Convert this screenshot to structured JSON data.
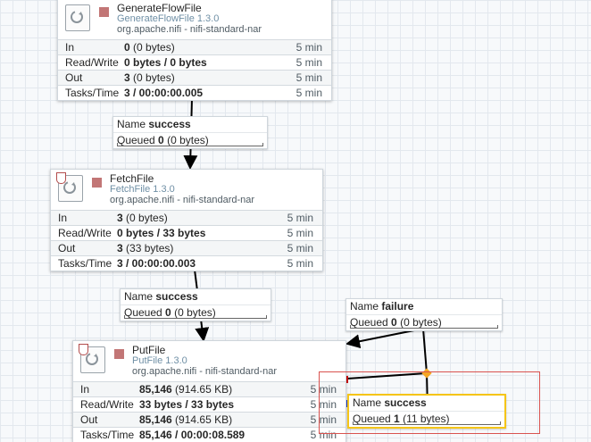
{
  "processors": [
    {
      "name": "GenerateFlowFile",
      "type": "GenerateFlowFile 1.3.0",
      "bundle": "org.apache.nifi - nifi-standard-nar",
      "stats": [
        {
          "label": "In",
          "count": "0",
          "detail": "(0 bytes)",
          "time": "5 min"
        },
        {
          "label": "Read/Write",
          "count": "0 bytes / 0 bytes",
          "detail": "",
          "time": "5 min"
        },
        {
          "label": "Out",
          "count": "3",
          "detail": "(0 bytes)",
          "time": "5 min"
        },
        {
          "label": "Tasks/Time",
          "count": "3 / 00:00:00.005",
          "detail": "",
          "time": "5 min"
        }
      ]
    },
    {
      "name": "FetchFile",
      "type": "FetchFile 1.3.0",
      "bundle": "org.apache.nifi - nifi-standard-nar",
      "stats": [
        {
          "label": "In",
          "count": "3",
          "detail": "(0 bytes)",
          "time": "5 min"
        },
        {
          "label": "Read/Write",
          "count": "0 bytes / 33 bytes",
          "detail": "",
          "time": "5 min"
        },
        {
          "label": "Out",
          "count": "3",
          "detail": "(33 bytes)",
          "time": "5 min"
        },
        {
          "label": "Tasks/Time",
          "count": "3 / 00:00:00.003",
          "detail": "",
          "time": "5 min"
        }
      ]
    },
    {
      "name": "PutFile",
      "type": "PutFile 1.3.0",
      "bundle": "org.apache.nifi - nifi-standard-nar",
      "stats": [
        {
          "label": "In",
          "count": "85,146",
          "detail": "(914.65 KB)",
          "time": "5 min"
        },
        {
          "label": "Read/Write",
          "count": "33 bytes / 33 bytes",
          "detail": "",
          "time": "5 min"
        },
        {
          "label": "Out",
          "count": "85,146",
          "detail": "(914.65 KB)",
          "time": "5 min"
        },
        {
          "label": "Tasks/Time",
          "count": "85,146 / 00:00:08.589",
          "detail": "",
          "time": "5 min"
        }
      ]
    }
  ],
  "connections": [
    {
      "name_label": "Name",
      "name": "success",
      "queued_label": "Queued",
      "queued_count": "0",
      "queued_detail": "(0 bytes)"
    },
    {
      "name_label": "Name",
      "name": "success",
      "queued_label": "Queued",
      "queued_count": "0",
      "queued_detail": "(0 bytes)"
    },
    {
      "name_label": "Name",
      "name": "failure",
      "queued_label": "Queued",
      "queued_count": "0",
      "queued_detail": "(0 bytes)"
    },
    {
      "name_label": "Name",
      "name": "success",
      "queued_label": "Queued",
      "queued_count": "1",
      "queued_detail": "(11 bytes)"
    }
  ],
  "colors": {
    "processor_square": "#c27676",
    "selection_box": "#d9534f",
    "selected_connection": "#f5c518",
    "bend_point": "#f5a623",
    "source_handle": "#cc0000",
    "target_handle": "#1f3fd6"
  },
  "icons": [
    "processor-icon",
    "shield-icon",
    "bend-point-handle",
    "connection-handle"
  ]
}
